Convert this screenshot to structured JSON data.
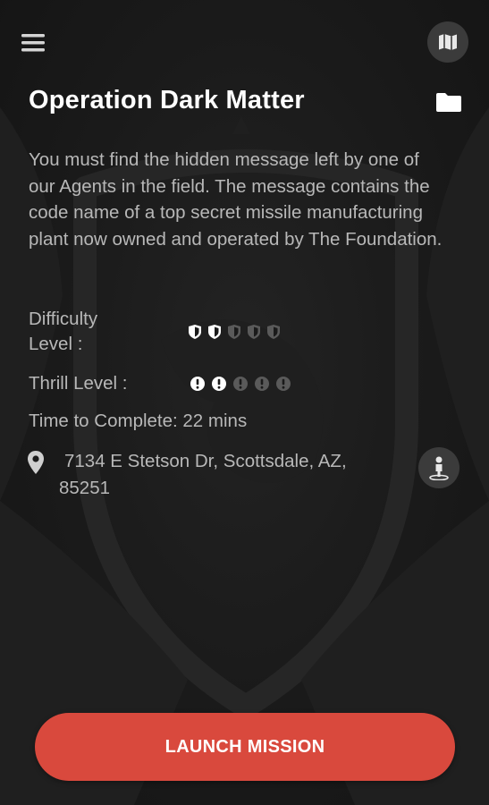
{
  "header": {
    "menu_icon": "hamburger-menu-icon",
    "map_icon": "map-icon"
  },
  "mission": {
    "title": "Operation Dark Matter",
    "folder_icon": "folder-icon",
    "description": "You must find the hidden message left by one of our Agents in the field.  The message contains the code name of a top secret missile manufacturing plant now owned and operated by The Foundation.",
    "difficulty_label": "Difficulty Level :",
    "difficulty_rating": 2,
    "difficulty_max": 5,
    "difficulty_icon": "shield-icon",
    "thrill_label": "Thrill Level :",
    "thrill_rating": 2,
    "thrill_max": 5,
    "thrill_icon": "exclamation-circle-icon",
    "time_label": "Time to Complete: 22 mins",
    "address": "7134 E Stetson Dr, Scottsdale, AZ, 85251",
    "location_icon": "map-pin-icon",
    "navigate_icon": "navigation-person-icon"
  },
  "actions": {
    "launch_label": "LAUNCH MISSION"
  },
  "colors": {
    "background": "#1a1a1a",
    "accent": "#d9493d",
    "text_primary": "#ffffff",
    "text_secondary": "#b8b8b8",
    "rating_active": "#ffffff",
    "rating_inactive": "#5a5a5a"
  }
}
